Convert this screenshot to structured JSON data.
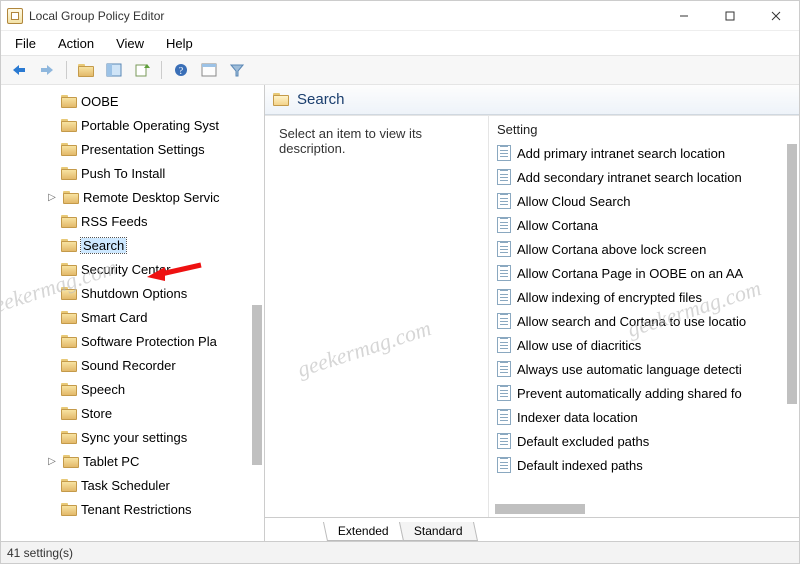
{
  "window": {
    "title": "Local Group Policy Editor"
  },
  "menu": {
    "file": "File",
    "action": "Action",
    "view": "View",
    "help": "Help"
  },
  "tree": {
    "items": [
      {
        "label": "OOBE"
      },
      {
        "label": "Portable Operating Syst"
      },
      {
        "label": "Presentation Settings"
      },
      {
        "label": "Push To Install"
      },
      {
        "label": "Remote Desktop Servic",
        "expandable": true
      },
      {
        "label": "RSS Feeds"
      },
      {
        "label": "Search",
        "selected": true
      },
      {
        "label": "Security Center"
      },
      {
        "label": "Shutdown Options"
      },
      {
        "label": "Smart Card"
      },
      {
        "label": "Software Protection Pla"
      },
      {
        "label": "Sound Recorder"
      },
      {
        "label": "Speech"
      },
      {
        "label": "Store"
      },
      {
        "label": "Sync your settings"
      },
      {
        "label": "Tablet PC",
        "expandable": true
      },
      {
        "label": "Task Scheduler"
      },
      {
        "label": "Tenant Restrictions"
      }
    ]
  },
  "right": {
    "header": "Search",
    "description": "Select an item to view its description.",
    "column_header": "Setting",
    "settings": [
      "Add primary intranet search location",
      "Add secondary intranet search location",
      "Allow Cloud Search",
      "Allow Cortana",
      "Allow Cortana above lock screen",
      "Allow Cortana Page in OOBE on an AA",
      "Allow indexing of encrypted files",
      "Allow search and Cortana to use locatio",
      "Allow use of diacritics",
      "Always use automatic language detecti",
      "Prevent automatically adding shared fo",
      "Indexer data location",
      "Default excluded paths",
      "Default indexed paths"
    ]
  },
  "tabs": {
    "extended": "Extended",
    "standard": "Standard"
  },
  "statusbar": {
    "text": "41 setting(s)"
  },
  "watermark": "geekermag.com"
}
